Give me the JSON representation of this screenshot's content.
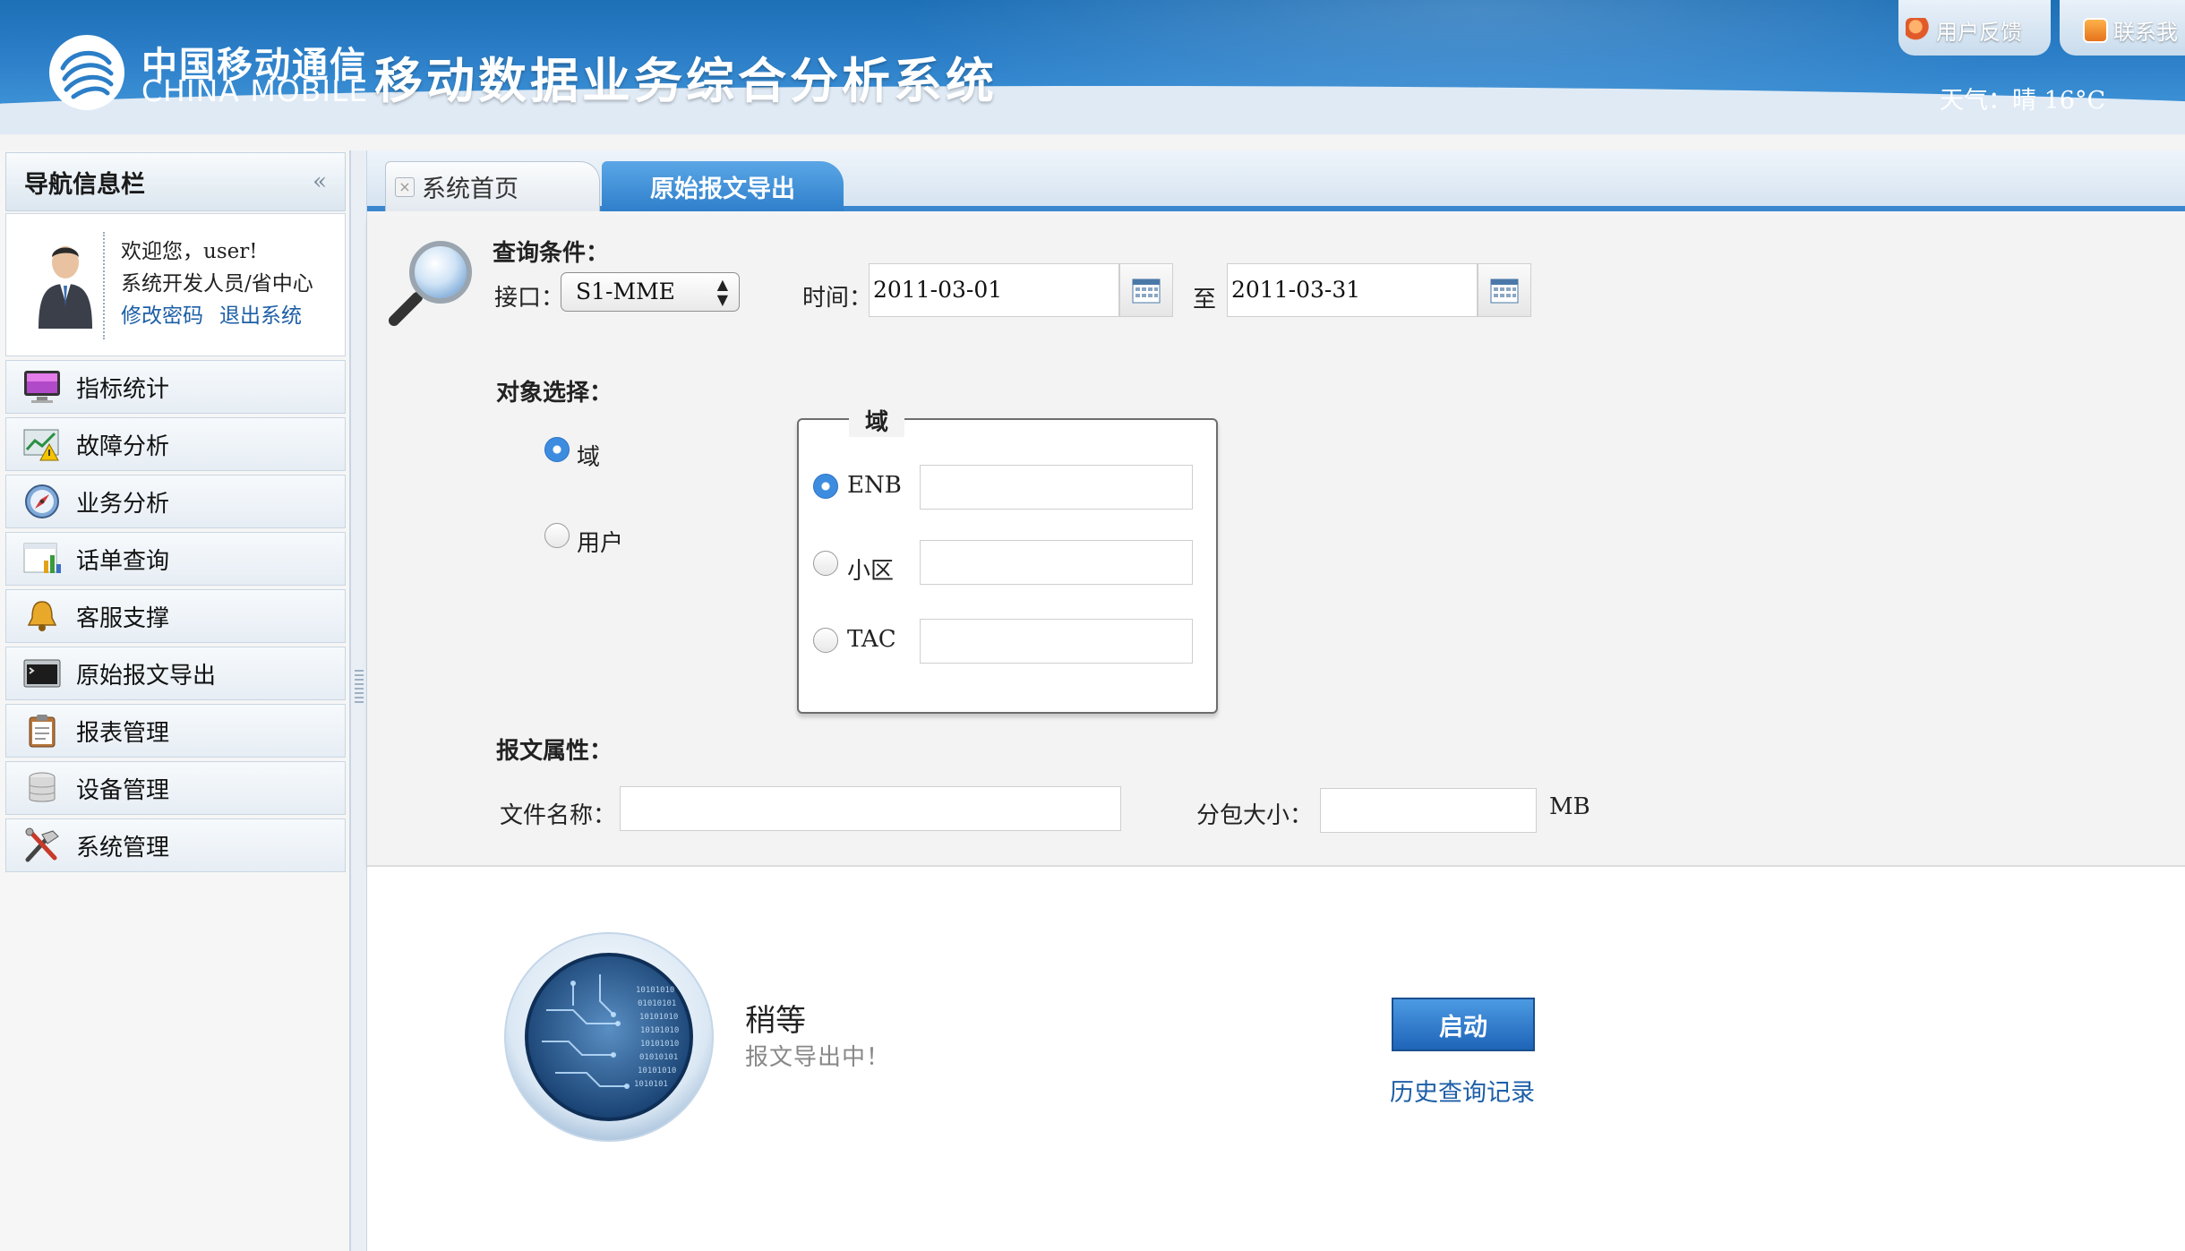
{
  "header": {
    "logo_cn": "中国移动通信",
    "logo_en": "CHINA MOBILE",
    "system_title": "移动数据业务综合分析系统",
    "feedback": "用户反馈",
    "contact": "联系我",
    "weather": "天气：晴 16°C"
  },
  "sidebar": {
    "title": "导航信息栏",
    "collapse": "«",
    "user": {
      "welcome": "欢迎您，user!",
      "role": "系统开发人员/省中心",
      "change_password": "修改密码",
      "logout": "退出系统"
    },
    "items": [
      {
        "label": "指标统计",
        "icon": "monitor-icon"
      },
      {
        "label": "故障分析",
        "icon": "warning-chart-icon"
      },
      {
        "label": "业务分析",
        "icon": "compass-icon"
      },
      {
        "label": "话单查询",
        "icon": "bar-chart-icon"
      },
      {
        "label": "客服支撑",
        "icon": "bell-icon"
      },
      {
        "label": "原始报文导出",
        "icon": "terminal-icon"
      },
      {
        "label": "报表管理",
        "icon": "clipboard-icon"
      },
      {
        "label": "设备管理",
        "icon": "database-icon"
      },
      {
        "label": "系统管理",
        "icon": "tools-icon"
      }
    ]
  },
  "tabs": [
    {
      "label": "系统首页",
      "active": false
    },
    {
      "label": "原始报文导出",
      "active": true
    }
  ],
  "query": {
    "section_label": "查询条件：",
    "interface_label": "接口：",
    "interface_value": "S1-MME",
    "time_label": "时间：",
    "date_from": "2011-03-01",
    "to_label": "至",
    "date_to": "2011-03-31",
    "object_label": "对象选择：",
    "object_options": [
      {
        "label": "域",
        "selected": true
      },
      {
        "label": "用户",
        "selected": false
      }
    ],
    "domain_group": {
      "legend": "域",
      "options": [
        {
          "label": "ENB",
          "selected": true,
          "value": ""
        },
        {
          "label": "小区",
          "selected": false,
          "value": ""
        },
        {
          "label": "TAC",
          "selected": false,
          "value": ""
        }
      ]
    },
    "message_attr_label": "报文属性：",
    "filename_label": "文件名称：",
    "filename_value": "",
    "packet_size_label": "分包大小：",
    "packet_size_value": "",
    "packet_size_unit": "MB"
  },
  "status": {
    "title": "稍等",
    "subtitle": "报文导出中！",
    "start_button": "启动",
    "history_link": "历史查询记录"
  },
  "colors": {
    "header_blue": "#2b7ec7",
    "tab_active": "#3a86cf",
    "link_blue": "#1d5fa7",
    "button_blue": "#1e64b8"
  }
}
